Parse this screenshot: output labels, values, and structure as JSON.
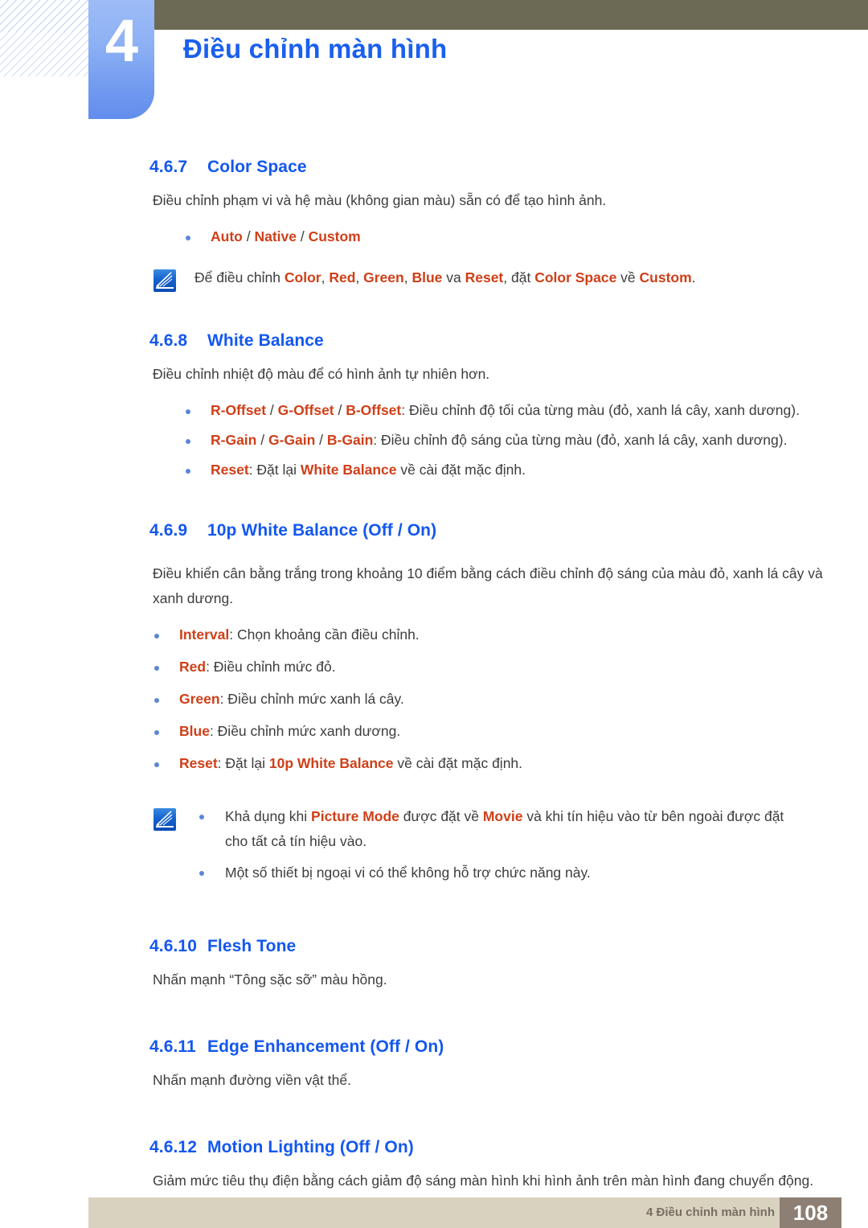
{
  "header": {
    "chapter_number": "4",
    "chapter_title": "Điều chỉnh màn hình",
    "olive_bar_color": "#6c6a54",
    "tab_color": "#8fb2f5",
    "title_color": "#1a5fee"
  },
  "colors": {
    "heading_blue": "#1357f0",
    "keyword_orange": "#cf3f18",
    "body_gray": "#3d3d3d",
    "bullet_blue": "#5b86d8",
    "footer_bar": "#d8d2bf",
    "footer_box": "#8d7f73"
  },
  "sections": [
    {
      "number": "4.6.7",
      "title": "Color Space",
      "body": "Điều chỉnh phạm vi và hệ màu (không gian màu) sẵn có để tạo hình ảnh.",
      "bullet_options": {
        "opt1": "Auto",
        "sep1": " / ",
        "opt2": "Native",
        "sep2": " / ",
        "opt3": "Custom"
      },
      "note": {
        "icon": "note-pen-icon",
        "t1": "Để điều chỉnh ",
        "k1": "Color",
        "t2": ", ",
        "k2": "Red",
        "t3": ", ",
        "k3": "Green",
        "t4": ", ",
        "k4": "Blue",
        "t5": " va ",
        "k5": "Reset",
        "t6": ", đặt ",
        "k6": "Color Space",
        "t7": " về ",
        "k7": "Custom",
        "t8": "."
      }
    },
    {
      "number": "4.6.8",
      "title": "White Balance",
      "body": "Điều chỉnh nhiệt độ màu để có hình ảnh tự nhiên hơn.",
      "items": [
        {
          "k1": "R-Offset",
          "s1": " / ",
          "k2": "G-Offset",
          "s2": " / ",
          "k3": "B-Offset",
          "rest": ": Điều chỉnh độ tối của từng màu (đỏ, xanh lá cây, xanh dương)."
        },
        {
          "k1": "R-Gain",
          "s1": " / ",
          "k2": "G-Gain",
          "s2": " / ",
          "k3": "B-Gain",
          "rest": ": Điều chỉnh độ sáng của từng màu (đỏ, xanh lá cây, xanh dương)."
        },
        {
          "k1": "Reset",
          "mid": ": Đặt lại ",
          "k2": "White Balance",
          "rest": " về cài đặt mặc định."
        }
      ]
    },
    {
      "number": "4.6.9",
      "title": "10p White Balance (Off / On)",
      "body": "Điều khiển cân bằng trắng trong khoảng 10 điểm bằng cách điều chỉnh độ sáng của màu đỏ, xanh lá cây và xanh dương.",
      "items": [
        {
          "k1": "Interval",
          "rest": ": Chọn khoảng cần điều chỉnh."
        },
        {
          "k1": "Red",
          "rest": ": Điều chỉnh mức đỏ."
        },
        {
          "k1": "Green",
          "rest": ": Điều chỉnh mức xanh lá cây."
        },
        {
          "k1": "Blue",
          "rest": ": Điều chỉnh mức xanh dương."
        },
        {
          "k1": "Reset",
          "mid": ": Đặt lại ",
          "k2": "10p White Balance",
          "rest": " về cài đặt mặc định."
        }
      ],
      "note": {
        "icon": "note-pen-icon",
        "line1": {
          "t1": "Khả dụng khi ",
          "k1": "Picture Mode",
          "t2": " được đặt về ",
          "k2": "Movie",
          "t3": " và khi tín hiệu vào từ bên ngoài được đặt cho tất cả tín hiệu vào."
        },
        "line2": "Một số thiết bị ngoại vi có thể không hỗ trợ chức năng này."
      }
    },
    {
      "number": "4.6.10",
      "title": "Flesh Tone",
      "body": "Nhấn mạnh “Tông sặc sỡ” màu hồng."
    },
    {
      "number": "4.6.11",
      "title": "Edge Enhancement (Off / On)",
      "body": "Nhấn mạnh đường viền vật thể."
    },
    {
      "number": "4.6.12",
      "title": "Motion Lighting (Off / On)",
      "body": "Giảm mức tiêu thụ điện bằng cách giảm độ sáng màn hình khi hình ảnh trên màn hình đang chuyển động."
    }
  ],
  "footer": {
    "text": "4 Điều chỉnh màn hình",
    "page_number": "108"
  }
}
